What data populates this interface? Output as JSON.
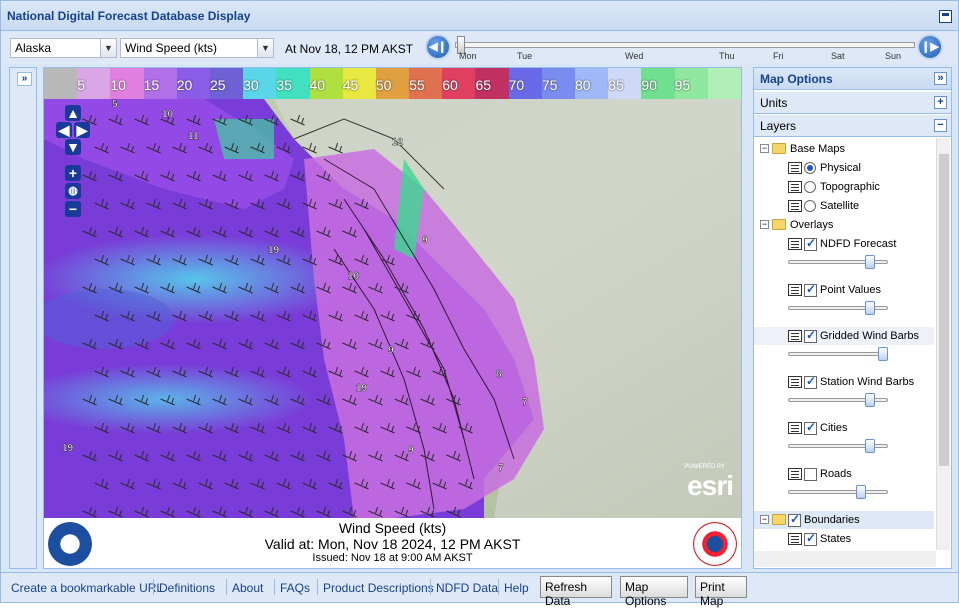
{
  "app": {
    "title": "National Digital Forecast Database Display"
  },
  "toolbar": {
    "region_value": "Alaska",
    "element_value": "Wind Speed (kts)",
    "at_time": "At Nov 18, 12 PM AKST",
    "timeline_days": [
      "Mon",
      "Tue",
      "Wed",
      "Thu",
      "Fri",
      "Sat",
      "Sun"
    ],
    "timeline_position_fraction": 0.0
  },
  "legend": {
    "labels": [
      "5",
      "10",
      "15",
      "20",
      "25",
      "30",
      "35",
      "40",
      "45",
      "50",
      "55",
      "60",
      "65",
      "70",
      "75",
      "80",
      "85",
      "90",
      "95"
    ],
    "colors": [
      "#b8b8b8",
      "#d9a6e6",
      "#e07fe0",
      "#b070e8",
      "#8b5ce8",
      "#7060d6",
      "#5ad6e8",
      "#40e0c0",
      "#b0e040",
      "#e8e840",
      "#e0a040",
      "#e07050",
      "#e04060",
      "#c03060",
      "#6a6ae8",
      "#7a8cf0",
      "#a0b8f8",
      "#d0d8f8",
      "#70e090",
      "#90e8a0",
      "#b0f0b8",
      "#d0f8d0",
      "#f8c070",
      "#f8a878",
      "#f09080",
      "#e06868"
    ],
    "units": "kts"
  },
  "map": {
    "attribution_small": "POWERED BY",
    "attribution": "esri",
    "point_labels": [
      "5",
      "10",
      "11",
      "12",
      "19",
      "9",
      "10",
      "9",
      "8",
      "7",
      "19",
      "19",
      "7",
      "9"
    ]
  },
  "caption": {
    "line1": "Wind Speed (kts)",
    "line2": "Valid at: Mon, Nov 18 2024, 12 PM AKST",
    "line3": "Issued: Nov 18 at 9:00 AM AKST",
    "left_logo": "NOAA",
    "right_logo": "NATIONAL WEATHER SERVICE"
  },
  "panel": {
    "title": "Map Options",
    "units_label": "Units",
    "layers_label": "Layers",
    "base_maps_label": "Base Maps",
    "base_maps": [
      {
        "label": "Physical",
        "selected": true
      },
      {
        "label": "Topographic",
        "selected": false
      },
      {
        "label": "Satellite",
        "selected": false
      }
    ],
    "overlays_label": "Overlays",
    "overlays": [
      {
        "label": "NDFD Forecast",
        "checked": true,
        "opacity": 0.85
      },
      {
        "label": "Point Values",
        "checked": true,
        "opacity": 0.85
      },
      {
        "label": "Gridded Wind Barbs",
        "checked": true,
        "opacity": 1.0
      },
      {
        "label": "Station Wind Barbs",
        "checked": true,
        "opacity": 0.85
      },
      {
        "label": "Cities",
        "checked": true,
        "opacity": 0.85
      },
      {
        "label": "Roads",
        "checked": false,
        "opacity": 0.75
      }
    ],
    "boundaries_label": "Boundaries",
    "boundaries": [
      {
        "label": "States",
        "checked": true
      }
    ]
  },
  "footer": {
    "links": [
      "Create a bookmarkable URL",
      "Definitions",
      "About",
      "FAQs",
      "Product Descriptions",
      "NDFD Data",
      "Help"
    ],
    "buttons": [
      "Refresh Data",
      "Map Options",
      "Print Map"
    ]
  }
}
